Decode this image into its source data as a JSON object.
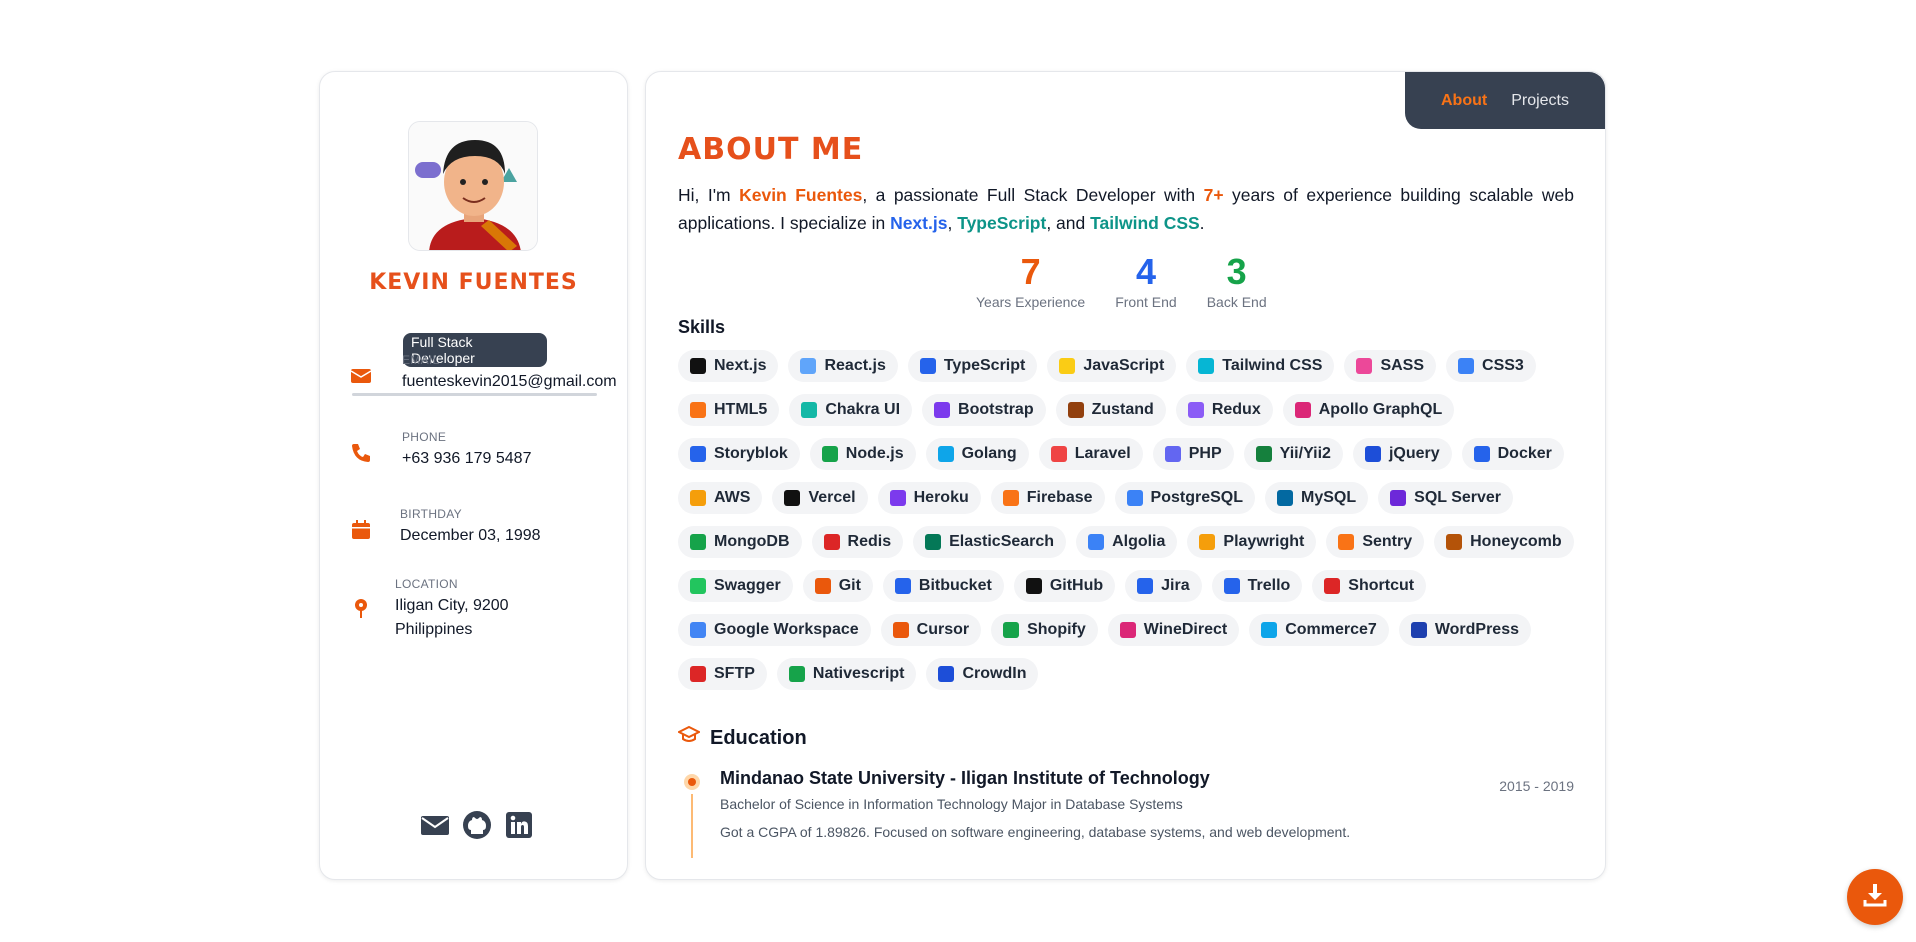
{
  "profile": {
    "name": "Kevin Fuentes",
    "role": "Full Stack Developer",
    "email_label": "Email",
    "email": "fuenteskevin2015@gmail.com",
    "phone_label": "Phone",
    "phone": "+63 936 179 5487",
    "birthday_label": "Birthday",
    "birthday": "December 03, 1998",
    "location_label": "Location",
    "location_line1": "Iligan City, 9200",
    "location_line2": "Philippines",
    "socials": [
      "mail-icon",
      "github-icon",
      "linkedin-icon"
    ]
  },
  "nav": {
    "about": "About",
    "projects": "Projects",
    "active": "About"
  },
  "about": {
    "title": "ABOUT ME",
    "intro_1": "Hi, I'm ",
    "intro_name": "Kevin Fuentes",
    "intro_2": ", a passionate Full Stack Developer with ",
    "intro_years": "7+",
    "intro_3": " years of experience building scalable web applications. I specialize in ",
    "intro_t1": "Next.js",
    "intro_sep1": ", ",
    "intro_t2": "TypeScript",
    "intro_sep2": ", and ",
    "intro_t3": "Tailwind CSS",
    "intro_end": "."
  },
  "stats": [
    {
      "value": "7",
      "caption": "Years Experience",
      "color": "#ea580c"
    },
    {
      "value": "4",
      "caption": "Front End",
      "color": "#2563eb"
    },
    {
      "value": "3",
      "caption": "Back End",
      "color": "#16a34a"
    }
  ],
  "skills_title": "Skills",
  "skills": [
    {
      "label": "Next.js",
      "color": "#111111"
    },
    {
      "label": "React.js",
      "color": "#60a5fa"
    },
    {
      "label": "TypeScript",
      "color": "#2563eb"
    },
    {
      "label": "JavaScript",
      "color": "#facc15"
    },
    {
      "label": "Tailwind CSS",
      "color": "#06b6d4"
    },
    {
      "label": "SASS",
      "color": "#ec4899"
    },
    {
      "label": "CSS3",
      "color": "#3b82f6"
    },
    {
      "label": "HTML5",
      "color": "#f97316"
    },
    {
      "label": "Chakra UI",
      "color": "#14b8a6"
    },
    {
      "label": "Bootstrap",
      "color": "#7c3aed"
    },
    {
      "label": "Zustand",
      "color": "#92400e"
    },
    {
      "label": "Redux",
      "color": "#8b5cf6"
    },
    {
      "label": "Apollo GraphQL",
      "color": "#db2777"
    },
    {
      "label": "Storyblok",
      "color": "#2563eb"
    },
    {
      "label": "Node.js",
      "color": "#16a34a"
    },
    {
      "label": "Golang",
      "color": "#0ea5e9"
    },
    {
      "label": "Laravel",
      "color": "#ef4444"
    },
    {
      "label": "PHP",
      "color": "#6366f1"
    },
    {
      "label": "Yii/Yii2",
      "color": "#15803d"
    },
    {
      "label": "jQuery",
      "color": "#1d4ed8"
    },
    {
      "label": "Docker",
      "color": "#2563eb"
    },
    {
      "label": "AWS",
      "color": "#f59e0b"
    },
    {
      "label": "Vercel",
      "color": "#111111"
    },
    {
      "label": "Heroku",
      "color": "#7c3aed"
    },
    {
      "label": "Firebase",
      "color": "#f97316"
    },
    {
      "label": "PostgreSQL",
      "color": "#3b82f6"
    },
    {
      "label": "MySQL",
      "color": "#0369a1"
    },
    {
      "label": "SQL Server",
      "color": "#6d28d9"
    },
    {
      "label": "MongoDB",
      "color": "#16a34a"
    },
    {
      "label": "Redis",
      "color": "#dc2626"
    },
    {
      "label": "ElasticSearch",
      "color": "#047857"
    },
    {
      "label": "Algolia",
      "color": "#3b82f6"
    },
    {
      "label": "Playwright",
      "color": "#f59e0b"
    },
    {
      "label": "Sentry",
      "color": "#f97316"
    },
    {
      "label": "Honeycomb",
      "color": "#b45309"
    },
    {
      "label": "Swagger",
      "color": "#22c55e"
    },
    {
      "label": "Git",
      "color": "#ea580c"
    },
    {
      "label": "Bitbucket",
      "color": "#2563eb"
    },
    {
      "label": "GitHub",
      "color": "#111111"
    },
    {
      "label": "Jira",
      "color": "#2563eb"
    },
    {
      "label": "Trello",
      "color": "#2563eb"
    },
    {
      "label": "Shortcut",
      "color": "#dc2626"
    },
    {
      "label": "Google Workspace",
      "color": "#4285f4"
    },
    {
      "label": "Cursor",
      "color": "#ea580c"
    },
    {
      "label": "Shopify",
      "color": "#16a34a"
    },
    {
      "label": "WineDirect",
      "color": "#db2777"
    },
    {
      "label": "Commerce7",
      "color": "#0ea5e9"
    },
    {
      "label": "WordPress",
      "color": "#1e40af"
    },
    {
      "label": "SFTP",
      "color": "#dc2626"
    },
    {
      "label": "Nativescript",
      "color": "#16a34a"
    },
    {
      "label": "CrowdIn",
      "color": "#1d4ed8"
    }
  ],
  "education": {
    "title": "Education",
    "school": "Mindanao State University - Iligan Institute of Technology",
    "degree": "Bachelor of Science in Information Technology Major in Database Systems",
    "description": "Got a CGPA of 1.89826. Focused on software engineering, database systems, and web development.",
    "years": "2015 - 2019"
  },
  "colors": {
    "accent": "#ea580c",
    "dark": "#374151"
  }
}
